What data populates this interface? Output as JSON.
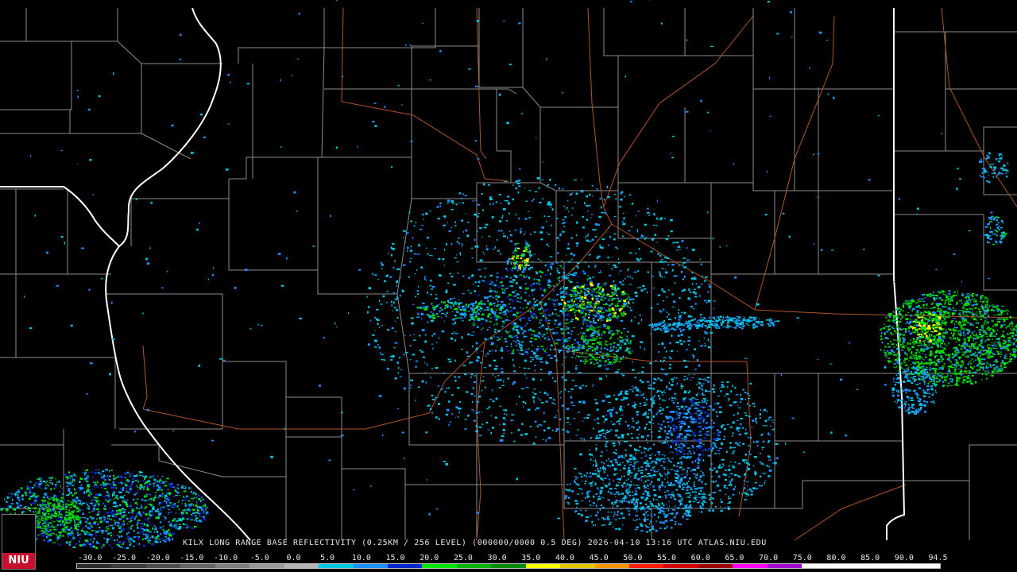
{
  "footer": {
    "title": "KILX LONG RANGE BASE REFLECTIVITY (0.25KM / 256 LEVEL) (000000/0000 0.5 DEG) 2026-04-10 13:16 UTC  ATLAS.NIU.EDU"
  },
  "scale": {
    "labels": [
      "-30.0",
      "-25.0",
      "-20.0",
      "-15.0",
      "-10.0",
      "-5.0",
      "0.0",
      "5.0",
      "10.0",
      "15.0",
      "20.0",
      "25.0",
      "30.0",
      "35.0",
      "40.0",
      "45.0",
      "50.0",
      "55.0",
      "60.0",
      "65.0",
      "70.0",
      "75.0",
      "80.0",
      "85.0",
      "90.0",
      "94.5"
    ],
    "colors": [
      "#2e2e2e",
      "#3d3d3d",
      "#4e4e4e",
      "#666666",
      "#7f7f7f",
      "#9a9a9a",
      "#b4b4b4",
      "#00c8e6",
      "#1e90ff",
      "#0028d2",
      "#00e600",
      "#00b400",
      "#008c00",
      "#ffff00",
      "#e6c800",
      "#ff9600",
      "#ff1e00",
      "#d20000",
      "#a00000",
      "#ff00ff",
      "#a000d2",
      "#ffffff",
      "#ffffff",
      "#ffffff",
      "#ffffff"
    ]
  },
  "logo": {
    "text": "NIU"
  },
  "colors": {
    "state_border": "#ffffff",
    "county_line": "#8c8c8c",
    "highway": "#b4552a",
    "background": "#000000"
  }
}
